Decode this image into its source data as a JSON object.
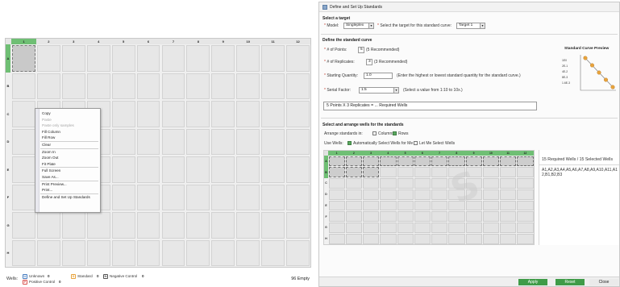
{
  "plate": {
    "columns": [
      "1",
      "2",
      "3",
      "4",
      "5",
      "6",
      "7",
      "8",
      "9",
      "10",
      "11",
      "12"
    ],
    "rows": [
      "A",
      "B",
      "C",
      "D",
      "E",
      "F",
      "G",
      "H"
    ]
  },
  "context_menu": {
    "items": [
      {
        "label": "Copy",
        "disabled": false,
        "sep_after": false
      },
      {
        "label": "Paste",
        "disabled": true,
        "sep_after": false
      },
      {
        "label": "Paste only samples",
        "disabled": true,
        "sep_after": false
      },
      {
        "label": "Fill Column",
        "disabled": false,
        "sep_after": false
      },
      {
        "label": "Fill Row",
        "disabled": false,
        "sep_after": true
      },
      {
        "label": "Clear",
        "disabled": false,
        "sep_after": true
      },
      {
        "label": "Zoom In",
        "disabled": false,
        "sep_after": false
      },
      {
        "label": "Zoom Out",
        "disabled": false,
        "sep_after": false
      },
      {
        "label": "Fit Plate",
        "disabled": false,
        "sep_after": true
      },
      {
        "label": "Full Screen",
        "disabled": false,
        "sep_after": false
      },
      {
        "label": "Save As...",
        "disabled": false,
        "sep_after": true
      },
      {
        "label": "Print Preview...",
        "disabled": false,
        "sep_after": false
      },
      {
        "label": "Print...",
        "disabled": false,
        "sep_after": true
      },
      {
        "label": "Define and Set Up Standards",
        "disabled": false,
        "sep_after": false
      }
    ]
  },
  "legend": {
    "wells_label": "Wells:",
    "unknown": {
      "badge": "U",
      "label": "Unknown",
      "count": "0",
      "color": "#4a7fc1"
    },
    "positive": {
      "badge": "P",
      "label": "Positive Control",
      "count": "0",
      "color": "#d9534f"
    },
    "standard": {
      "badge": "S",
      "label": "Standard",
      "count": "0",
      "color": "#e8a33c"
    },
    "negative": {
      "badge": "N",
      "label": "Negative Control",
      "count": "0",
      "color": "#555555"
    },
    "empty": "96 Empty"
  },
  "dialog": {
    "title": "Define and Set Up Standards",
    "target_section": "Select a target",
    "model_label": "Model:",
    "model_value": "Singleplex",
    "target_label": "Select the target for this standard curve:",
    "target_value": "Target 1",
    "curve_section": "Define the standard curve",
    "points_label": "# of Points:",
    "points_value": "5",
    "points_hint": "(5 Recommended)",
    "replicates_label": "# of Replicates:",
    "replicates_value": "3",
    "replicates_hint": "(3 Recommended)",
    "quantity_label": "Starting Quantity:",
    "quantity_value": "1.0",
    "quantity_hint": "(Enter the highest or lowest standard quantity for the standard curve.)",
    "serial_label": "Serial Factor:",
    "serial_value": "1:5",
    "serial_hint": "(Select a value from 1:10 to 10x.)",
    "summary": "5  Points X 3  Replicates = ...  Required Wells",
    "preview_title": "Standard Curve Preview",
    "preview_ticks": [
      "1E0",
      "2E-1",
      "4E-2",
      "8E-3",
      "1.6E-3"
    ],
    "arrange_section": "Select and arrange wells for the standards",
    "arrange_label": "Arrange standards in:",
    "columns_label": "Columns",
    "rows_label": "Rows",
    "use_wells_label": "Use Wells:",
    "auto_label": "Automatically Select Wells for Me",
    "manual_label": "Let Me Select Wells",
    "required_head": "15  Required Wells / 15  Selected Wells",
    "required_wells": "A1,A2,A3,A4,A5,A6,A7,A8,A9,A10,A11,A12,B1,B2,B3",
    "apply": "Apply",
    "reset": "Reset",
    "close": "Close"
  },
  "colors": {
    "selected_header": "#6fbf74",
    "apply_button": "#3f9b48",
    "curve_point": "#e8a33c"
  }
}
